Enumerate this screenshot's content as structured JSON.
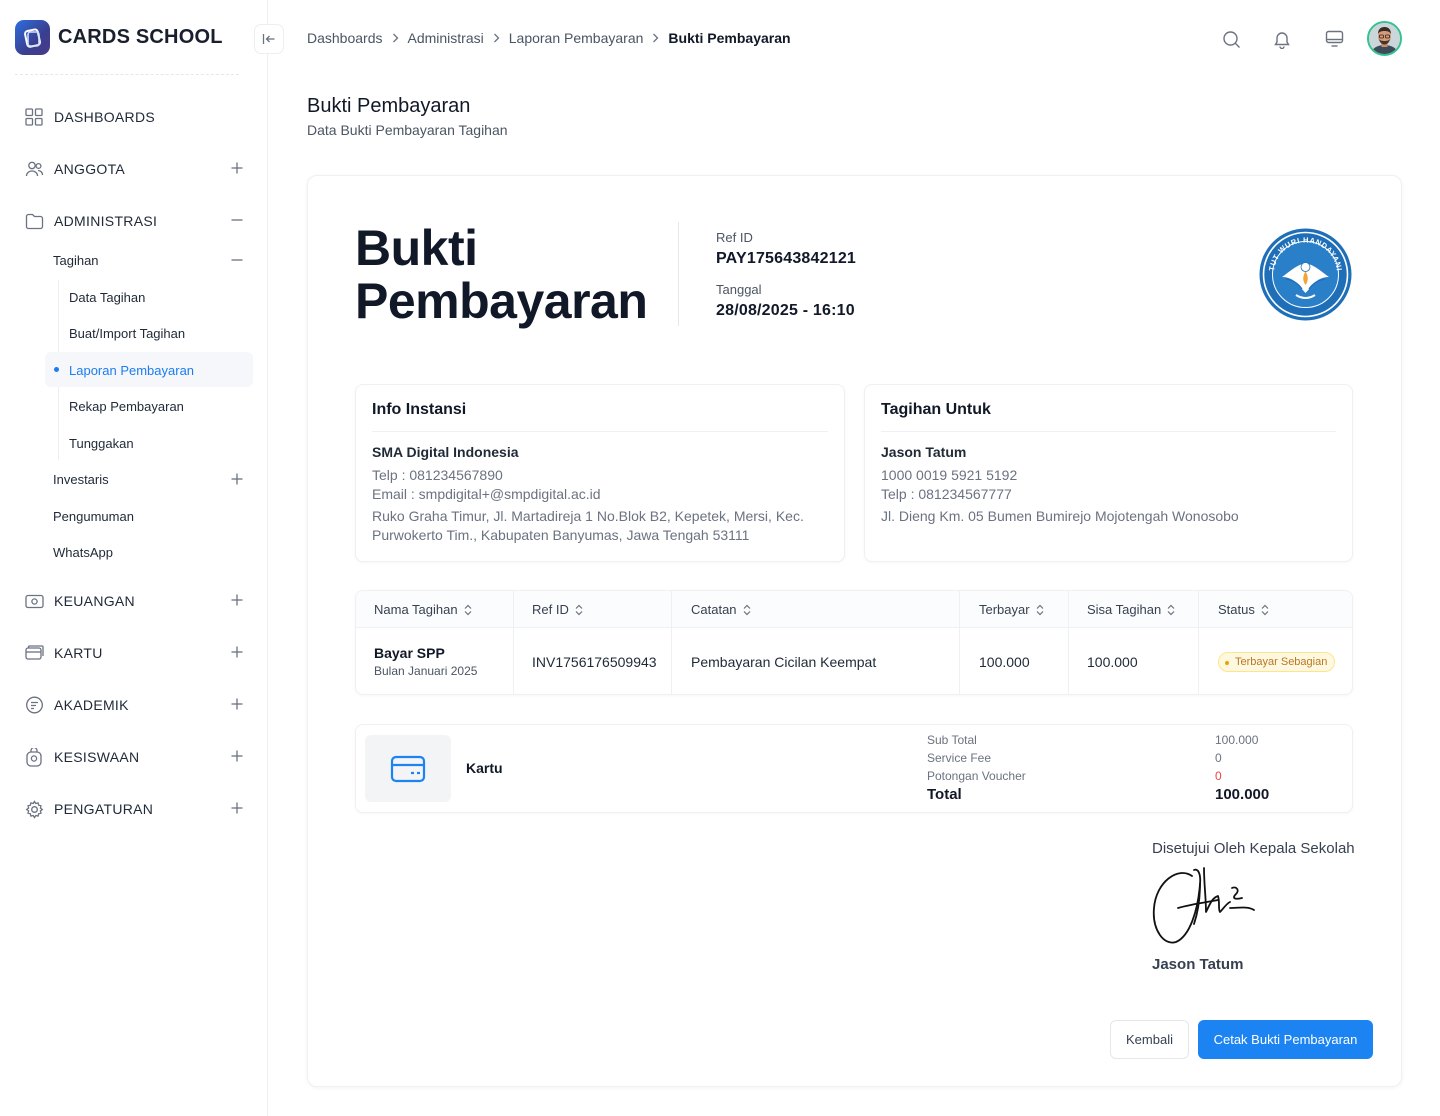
{
  "brand": {
    "name": "CARDS SCHOOL"
  },
  "sidebar": {
    "items": [
      {
        "label": "DASHBOARDS"
      },
      {
        "label": "ANGGOTA"
      },
      {
        "label": "ADMINISTRASI"
      },
      {
        "label": "KEUANGAN"
      },
      {
        "label": "KARTU"
      },
      {
        "label": "AKADEMIK"
      },
      {
        "label": "KESISWAAN"
      },
      {
        "label": "PENGATURAN"
      }
    ],
    "administrasi_children": [
      {
        "label": "Tagihan"
      },
      {
        "label": "Investaris"
      },
      {
        "label": "Pengumuman"
      },
      {
        "label": "WhatsApp"
      }
    ],
    "tagihan_children": [
      {
        "label": "Data Tagihan"
      },
      {
        "label": "Buat/Import Tagihan"
      },
      {
        "label": "Laporan Pembayaran"
      },
      {
        "label": "Rekap Pembayaran"
      },
      {
        "label": "Tunggakan"
      }
    ]
  },
  "breadcrumb": [
    "Dashboards",
    "Administrasi",
    "Laporan Pembayaran",
    "Bukti Pembayaran"
  ],
  "page": {
    "title": "Bukti Pembayaran",
    "subtitle": "Data Bukti Pembayaran Tagihan"
  },
  "receipt": {
    "big_title_line1": "Bukti",
    "big_title_line2": "Pembayaran",
    "ref_label": "Ref ID",
    "ref_value": "PAY175643842121",
    "date_label": "Tanggal",
    "date_value": "28/08/2025 - 16:10",
    "logo_text": "TUT WURI HANDAYANI"
  },
  "institution": {
    "heading": "Info Instansi",
    "name": "SMA Digital Indonesia",
    "phone": "Telp : 081234567890",
    "email": "Email : smpdigital+@smpdigital.ac.id",
    "address_line1": "Ruko Graha Timur, Jl. Martadireja 1 No.Blok B2, Kepetek, Mersi, Kec.",
    "address_line2": "Purwokerto Tim., Kabupaten Banyumas, Jawa Tengah 53111"
  },
  "billed_to": {
    "heading": "Tagihan Untuk",
    "name": "Jason Tatum",
    "card_number": "1000 0019 5921 5192",
    "phone": "Telp : 081234567777",
    "address": "Jl. Dieng Km. 05 Bumen Bumirejo Mojotengah Wonosobo"
  },
  "table": {
    "headers": [
      "Nama Tagihan",
      "Ref ID",
      "Catatan",
      "Terbayar",
      "Sisa Tagihan",
      "Status"
    ],
    "rows": [
      {
        "name": "Bayar SPP",
        "period": "Bulan Januari 2025",
        "ref_id": "INV1756176509943",
        "note": "Pembayaran Cicilan Keempat",
        "paid": "100.000",
        "remaining": "100.000",
        "status": "Terbayar Sebagian"
      }
    ]
  },
  "payment": {
    "method": "Kartu",
    "sub_total_label": "Sub Total",
    "sub_total_value": "100.000",
    "service_fee_label": "Service Fee",
    "service_fee_value": "0",
    "voucher_label": "Potongan Voucher",
    "voucher_value": "0",
    "total_label": "Total",
    "total_value": "100.000"
  },
  "approval": {
    "label": "Disetujui Oleh Kepala Sekolah",
    "signer": "Jason Tatum"
  },
  "actions": {
    "back_label": "Kembali",
    "print_label": "Cetak Bukti Pembayaran"
  },
  "colors": {
    "accent": "#1c84f2",
    "active_nav": "#1c7df0",
    "status_partial": "#b7791f",
    "danger": "#ef4444"
  }
}
